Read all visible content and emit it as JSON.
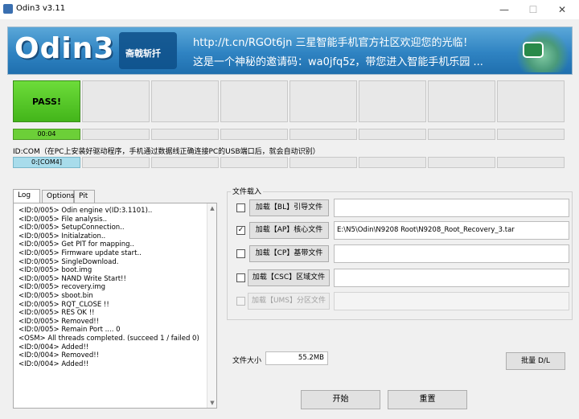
{
  "window": {
    "title": "Odin3 v3.11",
    "minimize": "—",
    "maximize": "☐",
    "close": "✕"
  },
  "banner": {
    "logo": "Odin3",
    "badge": "斋戟斩扦",
    "line1": "http://t.cn/RGOt6jn 三星智能手机官方社区欢迎您的光临！",
    "line2": "这是一个神秘的邀请码：wa0jfq5z，带您进入智能手机乐园 ...",
    "colors": {
      "top": "#5aa7d8",
      "bottom": "#1f6fae"
    }
  },
  "ports": {
    "status": [
      "PASS!",
      "",
      "",
      "",
      "",
      "",
      "",
      ""
    ],
    "times": [
      "00:04",
      "",
      "",
      "",
      "",
      "",
      "",
      ""
    ],
    "com_label": "ID:COM（在PC上安装好驱动程序，手机通过数据线正确连接PC的USB端口后，就会自动识别）",
    "coms": [
      "0:[COM4]",
      "",
      "",
      "",
      "",
      "",
      "",
      ""
    ],
    "pass_color": "#43b51a"
  },
  "tabs": [
    "Log",
    "Options",
    "Pit"
  ],
  "log": [
    "<ID:0/005> Odin engine v(ID:3.1101)..",
    "<ID:0/005> File analysis..",
    "<ID:0/005> SetupConnection..",
    "<ID:0/005> Initialzation..",
    "<ID:0/005> Get PIT for mapping..",
    "<ID:0/005> Firmware update start..",
    "<ID:0/005> SingleDownload.",
    "<ID:0/005> boot.img",
    "<ID:0/005> NAND Write Start!!",
    "<ID:0/005> recovery.img",
    "<ID:0/005> sboot.bin",
    "<ID:0/005> RQT_CLOSE !!",
    "<ID:0/005> RES OK !!",
    "<ID:0/005> Removed!!",
    "<ID:0/005> Remain Port ....  0",
    "<OSM> All threads completed. (succeed 1 / failed 0)",
    "<ID:0/004> Added!!",
    "<ID:0/004> Removed!!",
    "<ID:0/004> Added!!"
  ],
  "files": {
    "group_label": "文件载入",
    "rows": [
      {
        "checked": false,
        "enabled": true,
        "button": "加载【BL】引导文件",
        "path": ""
      },
      {
        "checked": true,
        "enabled": true,
        "button": "加载【AP】核心文件",
        "path": "E:\\N5\\Odin\\N9208 Root\\N9208_Root_Recovery_3.tar"
      },
      {
        "checked": false,
        "enabled": true,
        "button": "加载【CP】基带文件",
        "path": ""
      },
      {
        "checked": false,
        "enabled": true,
        "button": "加载【CSC】区域文件",
        "path": ""
      },
      {
        "checked": false,
        "enabled": false,
        "button": "加载【UMS】分区文件",
        "path": ""
      }
    ]
  },
  "size": {
    "label": "文件大小",
    "value": "55.2MB"
  },
  "buttons": {
    "batch": "批量 D/L",
    "start": "开始",
    "reset": "重置"
  }
}
